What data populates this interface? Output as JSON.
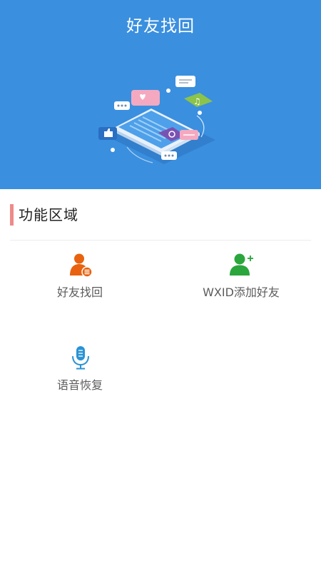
{
  "header": {
    "title": "好友找回",
    "background_color": "#3a8fdf",
    "illustration": "social-apps-phone-illustration"
  },
  "section": {
    "title": "功能区域",
    "accent_color": "#f08a8a"
  },
  "functions": [
    {
      "label": "好友找回",
      "icon": "user-list-icon",
      "color": "#e8620f"
    },
    {
      "label": "WXID添加好友",
      "icon": "user-add-icon",
      "color": "#2aa63c"
    },
    {
      "label": "语音恢复",
      "icon": "microphone-icon",
      "color": "#2a93d5"
    }
  ]
}
